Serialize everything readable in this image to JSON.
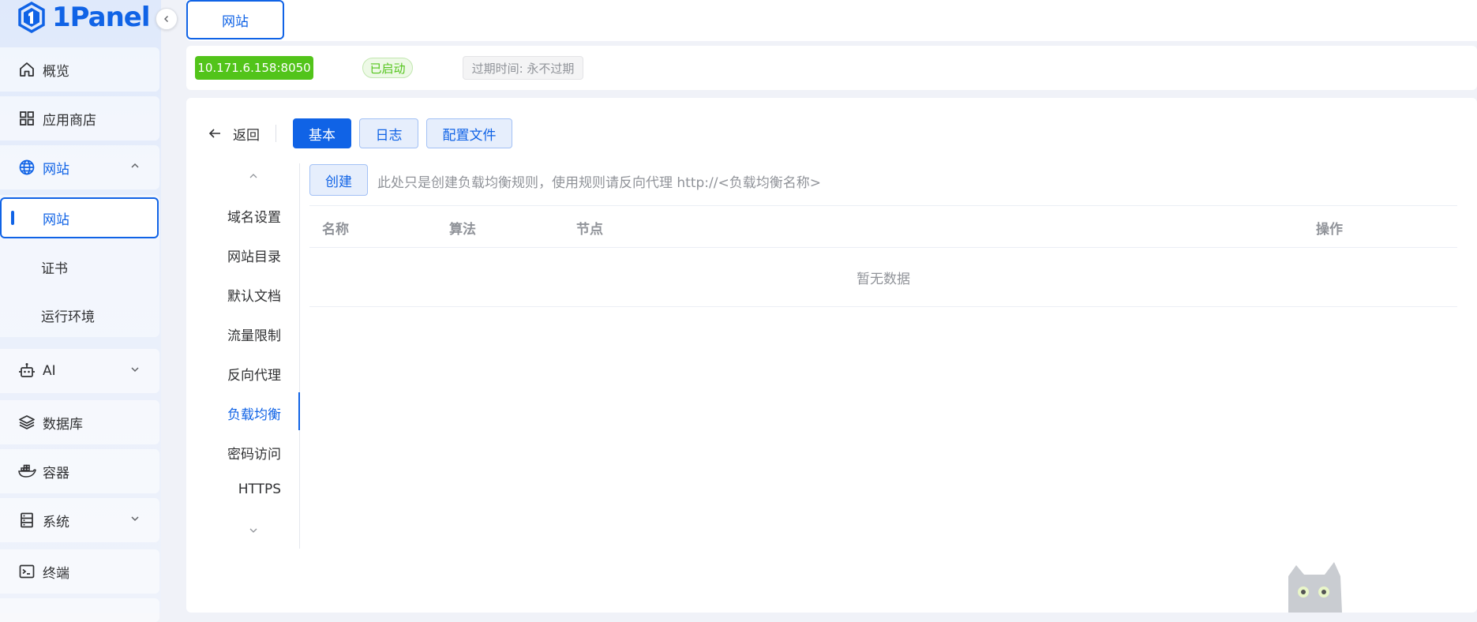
{
  "brand": {
    "name": "1Panel"
  },
  "sidebar": {
    "items": [
      {
        "label": "概览",
        "icon": "home-icon"
      },
      {
        "label": "应用商店",
        "icon": "apps-grid-icon"
      },
      {
        "label": "网站",
        "icon": "globe-icon",
        "expanded": true
      },
      {
        "label": "AI",
        "icon": "robot-icon"
      },
      {
        "label": "数据库",
        "icon": "layers-icon"
      },
      {
        "label": "容器",
        "icon": "docker-icon"
      },
      {
        "label": "系统",
        "icon": "server-icon"
      },
      {
        "label": "终端",
        "icon": "terminal-icon"
      }
    ],
    "website_sub": [
      {
        "label": "网站",
        "active": true
      },
      {
        "label": "证书"
      },
      {
        "label": "运行环境"
      }
    ]
  },
  "topbar": {
    "tab_label": "网站"
  },
  "status": {
    "address": "10.171.6.158:8050",
    "state": "已启动",
    "expire": "过期时间: 永不过期"
  },
  "toolbar": {
    "back_label": "返回",
    "tabs": [
      "基本",
      "日志",
      "配置文件"
    ],
    "active_tab": "基本"
  },
  "settings_nav": {
    "items": [
      "域名设置",
      "网站目录",
      "默认文档",
      "流量限制",
      "反向代理",
      "负载均衡",
      "密码访问",
      "HTTPS"
    ],
    "active": "负载均衡"
  },
  "load_balance": {
    "create_label": "创建",
    "hint": "此处只是创建负载均衡规则，使用规则请反向代理 http://<负载均衡名称>",
    "columns": [
      "名称",
      "算法",
      "节点",
      "操作"
    ],
    "empty_text": "暂无数据"
  },
  "colors": {
    "accent": "#1063e6",
    "success": "#52c41a"
  }
}
